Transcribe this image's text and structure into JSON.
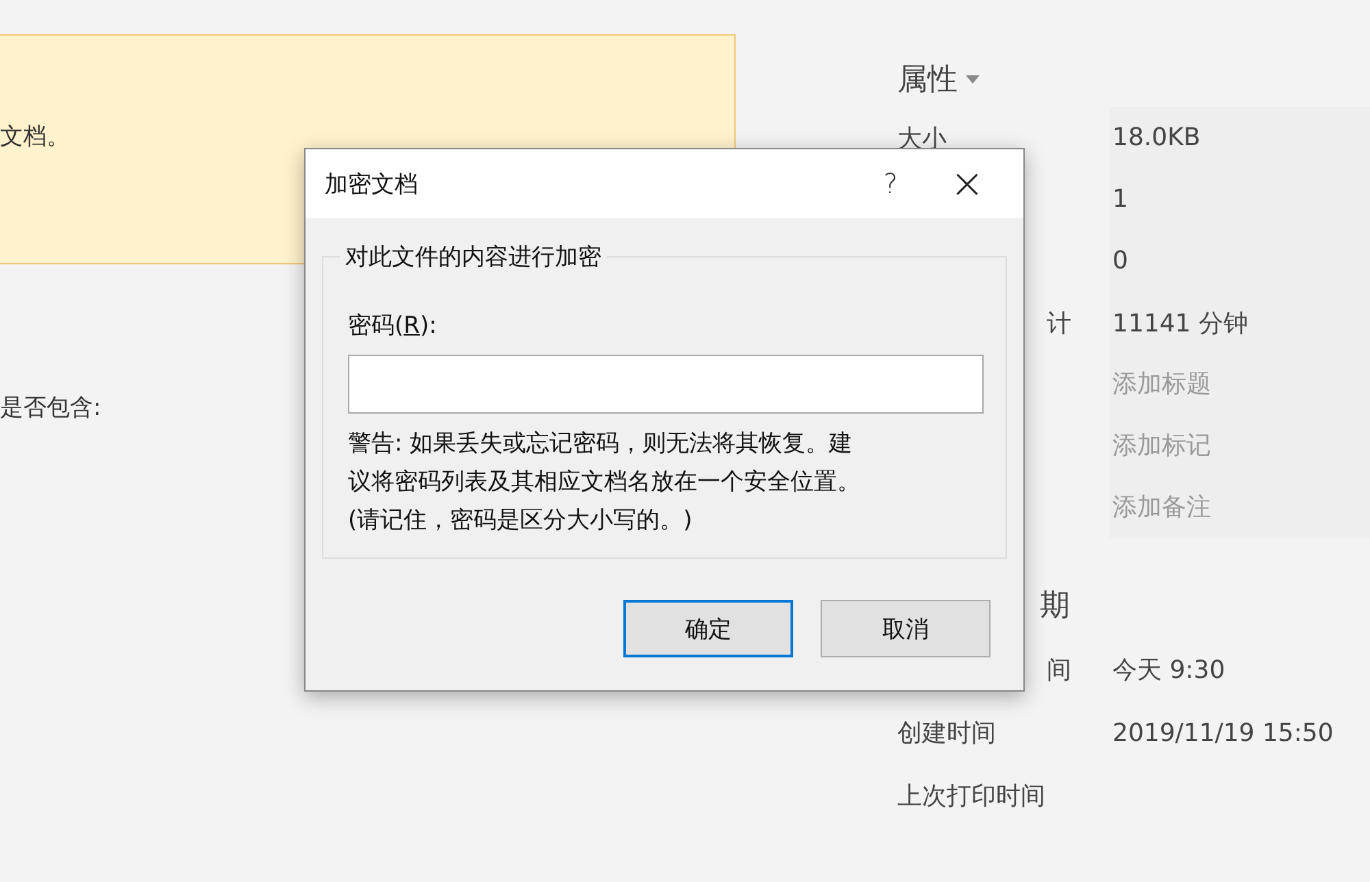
{
  "info_panel": {
    "notice": {
      "text": "文档。"
    },
    "inspect_text": "是否包含:"
  },
  "properties": {
    "heading": "属性",
    "rows": [
      {
        "label": "大小",
        "value": "18.0KB"
      },
      {
        "value": "1"
      },
      {
        "value": "0"
      },
      {
        "label_tail": "计",
        "value": "11141 分钟"
      },
      {
        "placeholder": "添加标题"
      },
      {
        "placeholder": "添加标记"
      },
      {
        "placeholder": "添加备注"
      }
    ]
  },
  "dates": {
    "heading_tail": "期",
    "rows": [
      {
        "label_tail": "间",
        "value": "今天 9:30"
      },
      {
        "label": "创建时间",
        "value": "2019/11/19 15:50"
      },
      {
        "label": "上次打印时间"
      }
    ]
  },
  "dialog": {
    "title": "加密文档",
    "help": "?",
    "close": "×",
    "group_title": "对此文件的内容进行加密",
    "password_label": [
      "密码(",
      "R",
      "):"
    ],
    "warning_lines": [
      "警告: 如果丢失或忘记密码，则无法将其恢复。建",
      "议将密码列表及其相应文档名放在一个安全位置。",
      "(请记住，密码是区分大小写的。)"
    ],
    "buttons": [
      {
        "label": "确定",
        "default": true
      },
      {
        "label": "取消",
        "default": false
      }
    ]
  }
}
